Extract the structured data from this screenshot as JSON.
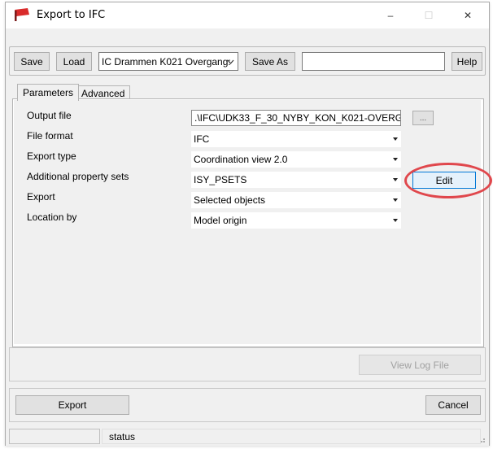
{
  "window": {
    "title": "Export to IFC",
    "controls": {
      "minimize": "–",
      "maximize": "☐",
      "close": "✕"
    }
  },
  "toolbar": {
    "save_label": "Save",
    "load_label": "Load",
    "config_value": "IC Drammen K021 Overgang:",
    "save_as_label": "Save As",
    "name_value": "",
    "help_label": "Help"
  },
  "tabs": [
    {
      "label": "Parameters",
      "active": true
    },
    {
      "label": "Advanced",
      "active": false
    }
  ],
  "parameters": {
    "output_file": {
      "label": "Output file",
      "value": ".\\IFC\\UDK33_F_30_NYBY_KON_K021-OVERG",
      "browse_label": "..."
    },
    "file_format": {
      "label": "File format",
      "value": "IFC"
    },
    "export_type": {
      "label": "Export type",
      "value": "Coordination view 2.0"
    },
    "property_sets": {
      "label": "Additional property sets",
      "value": "ISY_PSETS",
      "edit_label": "Edit"
    },
    "export": {
      "label": "Export",
      "value": "Selected objects"
    },
    "location_by": {
      "label": "Location by",
      "value": "Model origin"
    }
  },
  "log": {
    "view_log_label": "View Log File"
  },
  "footer": {
    "export_label": "Export",
    "cancel_label": "Cancel"
  },
  "statusbar": {
    "progress_text": "",
    "status_text": "status"
  },
  "colors": {
    "highlight_ring": "#e0474c",
    "edit_border": "#0078d7",
    "app_icon": "#d92b2b"
  },
  "icons": {
    "app": "ifc-export-icon",
    "grip": "resize-grip-icon"
  }
}
